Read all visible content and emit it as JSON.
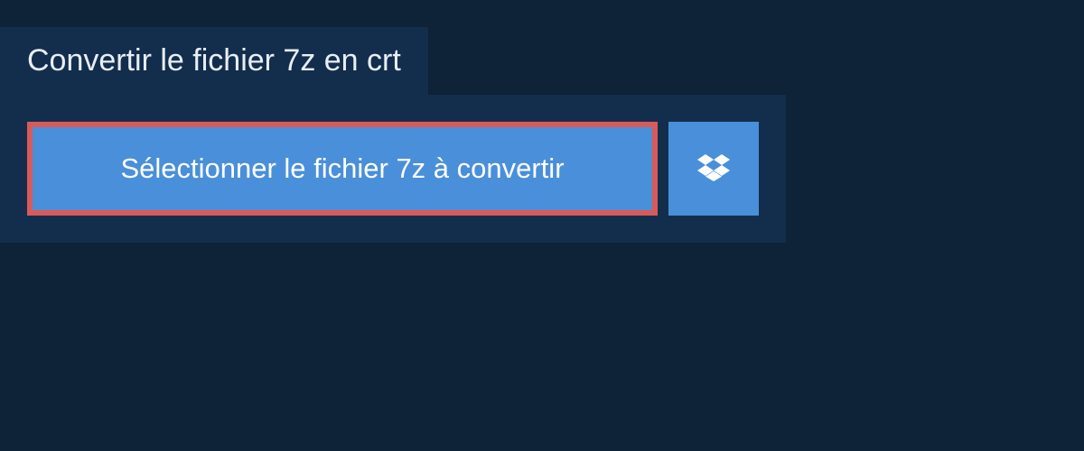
{
  "header": {
    "title": "Convertir le fichier 7z en crt"
  },
  "upload": {
    "select_button_label": "Sélectionner le fichier 7z à convertir",
    "dropbox_icon": "dropbox"
  },
  "colors": {
    "background": "#0e2238",
    "panel": "#132e4c",
    "button": "#4a8fd9",
    "highlight_border": "#d95a5a",
    "text_light": "#e8eef4"
  }
}
